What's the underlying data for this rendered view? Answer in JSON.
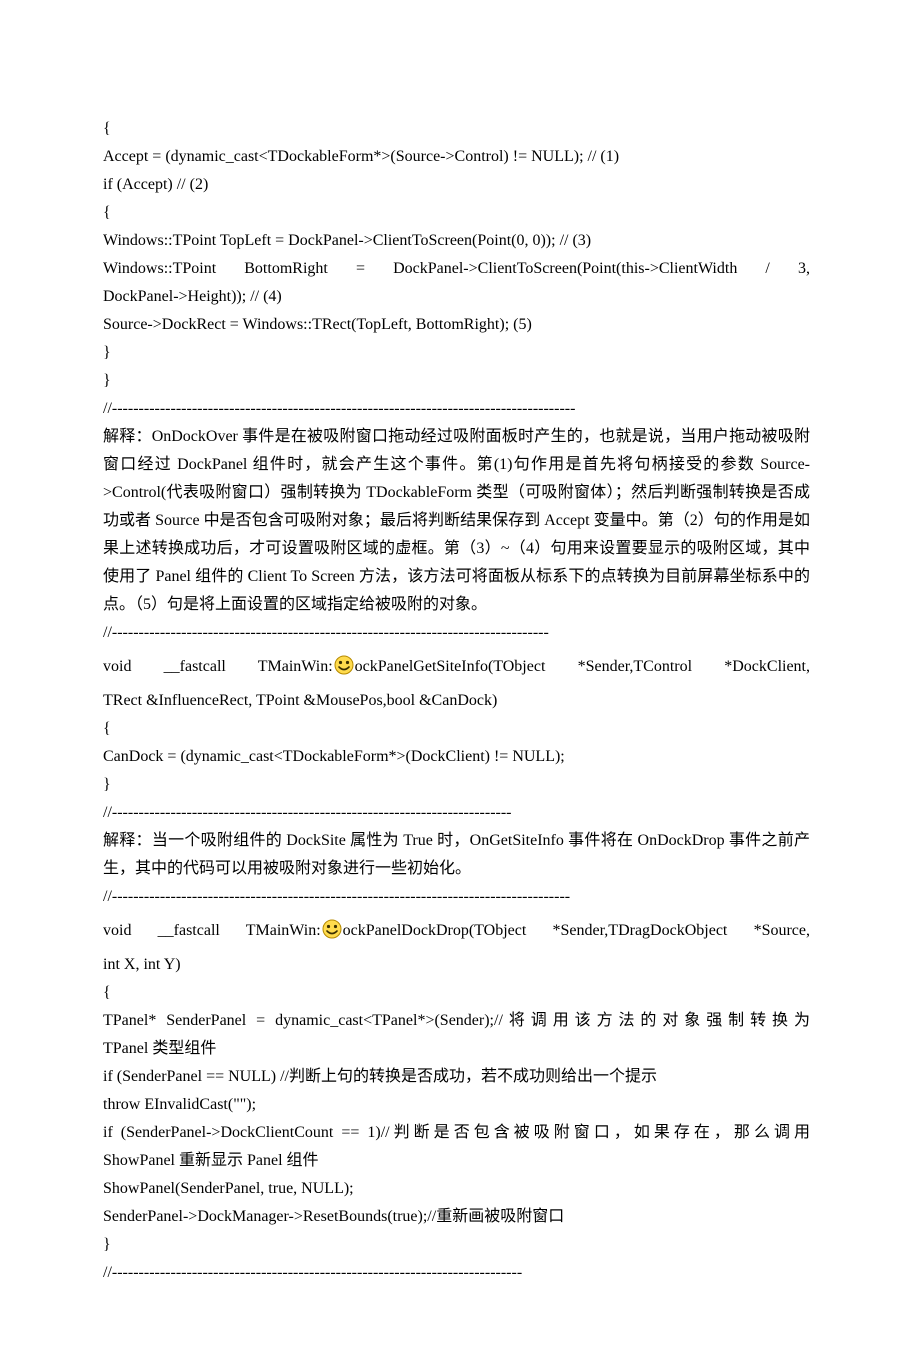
{
  "lines": {
    "l1": "{",
    "l2": "Accept = (dynamic_cast<TDockableForm*>(Source->Control) != NULL);    //  (1)",
    "l3": "if (Accept)             // (2)",
    "l4": "{",
    "l5": "Windows::TPoint TopLeft = DockPanel->ClientToScreen(Point(0, 0));   // (3)",
    "l6": "Windows::TPoint  BottomRight  =  DockPanel->ClientToScreen(Point(this->ClientWidth  /  3,",
    "l7": "DockPanel->Height));   // (4)",
    "l8": "Source->DockRect = Windows::TRect(TopLeft, BottomRight);  (5)",
    "l9": "}",
    "l10": "}",
    "sep1": "//---------------------------------------------------------------------------------------",
    "p1": "解释：OnDockOver 事件是在被吸附窗口拖动经过吸附面板时产生的，也就是说，当用户拖动被吸附窗口经过 DockPanel 组件时，就会产生这个事件。第(1)句作用是首先将句柄接受的参数 Source->Control(代表吸附窗口）强制转换为 TDockableForm 类型（可吸附窗体）；然后判断强制转换是否成功或者 Source 中是否包含可吸附对象；最后将判断结果保存到 Accept 变量中。第（2）句的作用是如果上述转换成功后，才可设置吸附区域的虚框。第（3）~（4）句用来设置要显示的吸附区域，其中使用了 Panel 组件的 Client To Screen 方法，该方法可将面板从标系下的点转换为目前屏幕坐标系中的点。（5）句是将上面设置的区域指定给被吸附的对象。",
    "sep2": "//----------------------------------------------------------------------------------",
    "l11a": "void   __fastcall  TMainWin:",
    "l11b": "ockPanelGetSiteInfo(TObject   *Sender,TControl   *DockClient,",
    "l12": "TRect &InfluenceRect, TPoint &MousePos,bool &CanDock)",
    "l13": "{",
    "l14": "CanDock = (dynamic_cast<TDockableForm*>(DockClient) != NULL);",
    "l15": "}",
    "sep3": "//---------------------------------------------------------------------------",
    "p2": "解释：当一个吸附组件的 DockSite 属性为 True 时，OnGetSiteInfo 事件将在 OnDockDrop 事件之前产生，其中的代码可以用被吸附对象进行一些初始化。",
    "sep4": "//--------------------------------------------------------------------------------------",
    "l16a": "void  __fastcall  TMainWin:",
    "l16b": "ockPanelDockDrop(TObject  *Sender,TDragDockObject  *Source,",
    "l17": "int X, int Y)",
    "l18": "{",
    "l19": "TPanel* SenderPanel = dynamic_cast<TPanel*>(Sender);//将调用该方法的对象强制转换为",
    "l20": "TPanel 类型组件",
    "l21": "if (SenderPanel == NULL) //判断上句的转换是否成功，若不成功则给出一个提示",
    "l22": "throw EInvalidCast(\"\");",
    "l23": "if (SenderPanel->DockClientCount == 1)//判断是否包含被吸附窗口，如果存在，那么调用",
    "l24": "ShowPanel 重新显示 Panel 组件",
    "l25": "ShowPanel(SenderPanel, true, NULL);",
    "l26": "SenderPanel->DockManager->ResetBounds(true);//重新画被吸附窗口",
    "l27": "}",
    "sep5": "//-----------------------------------------------------------------------------"
  }
}
